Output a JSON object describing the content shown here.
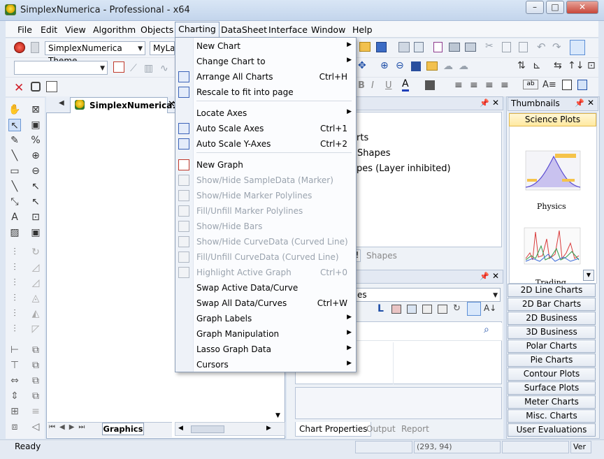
{
  "window": {
    "title": "SimplexNumerica - Professional - x64",
    "minimize": "–",
    "maximize": "□",
    "close": "✕"
  },
  "menubar": [
    "File",
    "Edit",
    "View",
    "Algorithm",
    "Objects",
    "Charting",
    "DataSheet",
    "Interface",
    "Window",
    "Help"
  ],
  "toolbar": {
    "theme_combo": "SimplexNumerica Theme",
    "layout_combo": "MyLay"
  },
  "document": {
    "tab_title": "SimplexNumerica1",
    "bottom_tab": "Graphics"
  },
  "tree": {
    "lines": [
      "rts",
      "Shapes",
      "pes (Layer inhibited)"
    ],
    "tabs": [
      "!",
      "Shapes"
    ]
  },
  "properties": {
    "combo_text": "es"
  },
  "bottom_tabs": [
    "Chart Properties",
    "Output",
    "Report"
  ],
  "thumbnails": {
    "title": "Thumbnails",
    "selected": "Science Plots",
    "labels": [
      "Physics",
      "Trading"
    ],
    "categories": [
      "2D Line Charts",
      "2D Bar Charts",
      "2D Business",
      "3D Business",
      "Polar Charts",
      "Pie Charts",
      "Contour Plots",
      "Surface Plots",
      "Meter Charts",
      "Misc. Charts",
      "User Evaluations"
    ]
  },
  "statusbar": {
    "status": "Ready",
    "coords": "(293, 94)",
    "right": "Ver"
  },
  "charting_menu": [
    {
      "label": "New Chart",
      "shortcut": "",
      "submenu": true,
      "enabled": true
    },
    {
      "label": "Change Chart to",
      "shortcut": "",
      "submenu": true,
      "enabled": true
    },
    {
      "label": "Arrange All Charts",
      "shortcut": "Ctrl+H",
      "submenu": false,
      "enabled": true
    },
    {
      "label": "Rescale to fit into page",
      "shortcut": "",
      "submenu": false,
      "enabled": true
    },
    {
      "label": "Locate Axes",
      "shortcut": "",
      "submenu": true,
      "enabled": true
    },
    {
      "label": "Auto Scale Axes",
      "shortcut": "Ctrl+1",
      "submenu": false,
      "enabled": true
    },
    {
      "label": "Auto Scale Y-Axes",
      "shortcut": "Ctrl+2",
      "submenu": false,
      "enabled": true
    },
    {
      "label": "New Graph",
      "shortcut": "",
      "submenu": false,
      "enabled": true
    },
    {
      "label": "Show/Hide SampleData (Marker)",
      "shortcut": "",
      "submenu": false,
      "enabled": false
    },
    {
      "label": "Show/Hide Marker Polylines",
      "shortcut": "",
      "submenu": false,
      "enabled": false
    },
    {
      "label": "Fill/Unfill Marker Polylines",
      "shortcut": "",
      "submenu": false,
      "enabled": false
    },
    {
      "label": "Show/Hide Bars",
      "shortcut": "",
      "submenu": false,
      "enabled": false
    },
    {
      "label": "Show/Hide CurveData (Curved Line)",
      "shortcut": "",
      "submenu": false,
      "enabled": false
    },
    {
      "label": "Fill/Unfill CurveData (Curved Line)",
      "shortcut": "",
      "submenu": false,
      "enabled": false
    },
    {
      "label": "Highlight Active Graph",
      "shortcut": "Ctrl+0",
      "submenu": false,
      "enabled": false
    },
    {
      "label": "Swap Active Data/Curve",
      "shortcut": "",
      "submenu": false,
      "enabled": true
    },
    {
      "label": "Swap All Data/Curves",
      "shortcut": "Ctrl+W",
      "submenu": false,
      "enabled": true
    },
    {
      "label": "Graph Labels",
      "shortcut": "",
      "submenu": true,
      "enabled": true
    },
    {
      "label": "Graph Manipulation",
      "shortcut": "",
      "submenu": true,
      "enabled": true
    },
    {
      "label": "Lasso Graph Data",
      "shortcut": "",
      "submenu": true,
      "enabled": true
    },
    {
      "label": "Cursors",
      "shortcut": "",
      "submenu": true,
      "enabled": true
    }
  ]
}
